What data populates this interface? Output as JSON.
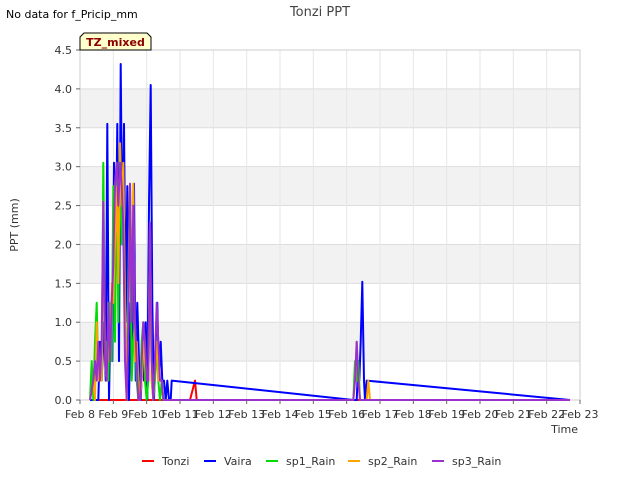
{
  "chart_data": {
    "type": "line",
    "title": "Tonzi PPT",
    "note": "No data for f_Pricip_mm",
    "badge": "TZ_mixed",
    "xlabel": "Time",
    "ylabel": "PPT (mm)",
    "xlim": [
      8,
      23
    ],
    "ylim": [
      0,
      4.5
    ],
    "x_ticks": [
      {
        "v": 8,
        "label": "Feb 8"
      },
      {
        "v": 9,
        "label": "Feb 9"
      },
      {
        "v": 10,
        "label": "Feb 10"
      },
      {
        "v": 11,
        "label": "Feb 11"
      },
      {
        "v": 12,
        "label": "Feb 12"
      },
      {
        "v": 13,
        "label": "Feb 13"
      },
      {
        "v": 14,
        "label": "Feb 14"
      },
      {
        "v": 15,
        "label": "Feb 15"
      },
      {
        "v": 16,
        "label": "Feb 16"
      },
      {
        "v": 17,
        "label": "Feb 17"
      },
      {
        "v": 18,
        "label": "Feb 18"
      },
      {
        "v": 19,
        "label": "Feb 19"
      },
      {
        "v": 20,
        "label": "Feb 20"
      },
      {
        "v": 21,
        "label": "Feb 21"
      },
      {
        "v": 22,
        "label": "Feb 22"
      },
      {
        "v": 23,
        "label": "Feb 23"
      }
    ],
    "y_ticks": [
      {
        "v": 0,
        "label": "0.0"
      },
      {
        "v": 0.5,
        "label": "0.5"
      },
      {
        "v": 1,
        "label": "1.0"
      },
      {
        "v": 1.5,
        "label": "1.5"
      },
      {
        "v": 2,
        "label": "2.0"
      },
      {
        "v": 2.5,
        "label": "2.5"
      },
      {
        "v": 3,
        "label": "3.0"
      },
      {
        "v": 3.5,
        "label": "3.5"
      },
      {
        "v": 4,
        "label": "4.0"
      },
      {
        "v": 4.5,
        "label": "4.5"
      }
    ],
    "grid": true,
    "legend": "bottom",
    "series": [
      {
        "name": "Tonzi",
        "color": "#ff0000",
        "x": [
          8.3,
          11.3,
          11.45,
          11.5,
          22.7
        ],
        "y": [
          0,
          0,
          0.25,
          0,
          0
        ]
      },
      {
        "name": "Vaira",
        "color": "#0000ff",
        "x": [
          8.3,
          8.55,
          8.6,
          8.65,
          8.72,
          8.77,
          8.82,
          8.87,
          8.92,
          8.97,
          9.02,
          9.07,
          9.12,
          9.17,
          9.22,
          9.27,
          9.32,
          9.37,
          9.42,
          9.47,
          9.52,
          9.57,
          9.62,
          9.67,
          9.72,
          9.77,
          9.82,
          9.87,
          9.92,
          9.97,
          10.02,
          10.07,
          10.12,
          10.17,
          10.22,
          10.27,
          10.32,
          10.37,
          10.42,
          10.47,
          10.52,
          10.57,
          10.62,
          10.67,
          10.72,
          10.75,
          16.2,
          16.3,
          16.35,
          16.38,
          16.42,
          16.47,
          16.52,
          16.55,
          16.6,
          22.7
        ],
        "y": [
          0,
          0,
          0.75,
          0.25,
          1.0,
          0.25,
          3.55,
          0,
          1.25,
          0.5,
          3.05,
          1.75,
          3.55,
          0.5,
          4.32,
          2.0,
          3.55,
          1.0,
          2.75,
          0,
          1.25,
          0.5,
          2.78,
          0.25,
          1.25,
          0.5,
          0,
          0.5,
          0.25,
          1.0,
          0,
          2.52,
          4.05,
          1.25,
          0,
          0.75,
          1.25,
          0.25,
          0.75,
          0.25,
          0.25,
          0,
          0.25,
          0,
          0,
          0.25,
          0,
          0,
          0.5,
          0.25,
          0.75,
          1.52,
          0.25,
          0,
          0.25,
          0
        ]
      },
      {
        "name": "sp1_Rain",
        "color": "#00dd00",
        "x": [
          8.3,
          8.35,
          8.4,
          8.45,
          8.5,
          8.55,
          8.6,
          8.65,
          8.7,
          8.75,
          8.8,
          8.85,
          8.9,
          8.95,
          9.0,
          9.05,
          9.1,
          9.15,
          9.2,
          9.25,
          9.3,
          9.35,
          9.4,
          9.45,
          9.5,
          9.55,
          9.6,
          9.65,
          9.7,
          9.75,
          9.8,
          9.85,
          9.9,
          9.95,
          10.0,
          10.05,
          10.1,
          10.15,
          10.2,
          10.25,
          10.3,
          10.35,
          10.4,
          10.45,
          10.5,
          16.2,
          16.25,
          16.3,
          16.35,
          16.4,
          22.7
        ],
        "y": [
          0,
          0.5,
          0,
          0.75,
          1.25,
          0.25,
          0.5,
          0.25,
          3.05,
          0.5,
          0.75,
          0.25,
          1.25,
          0.5,
          2.75,
          0.75,
          3.05,
          1.0,
          3.28,
          2.0,
          2.55,
          0.75,
          0,
          1.5,
          2.78,
          0.25,
          0.75,
          1.0,
          0.25,
          0,
          0,
          0.75,
          1.0,
          0.25,
          0,
          0.25,
          2.0,
          0.25,
          0,
          0.25,
          0.75,
          0.25,
          0,
          0.25,
          0,
          0,
          0.5,
          0.25,
          0.5,
          0,
          0
        ]
      },
      {
        "name": "sp2_Rain",
        "color": "#ffa500",
        "x": [
          8.3,
          8.4,
          8.45,
          8.5,
          8.55,
          8.6,
          8.65,
          8.7,
          8.75,
          8.8,
          8.85,
          8.9,
          8.95,
          9.0,
          9.05,
          9.1,
          9.15,
          9.2,
          9.25,
          9.3,
          9.35,
          9.4,
          9.45,
          9.5,
          9.55,
          9.6,
          9.65,
          9.7,
          9.75,
          9.8,
          9.85,
          9.9,
          9.95,
          10.0,
          10.05,
          10.1,
          10.15,
          10.2,
          10.25,
          10.3,
          10.35,
          10.4,
          10.45,
          10.5,
          16.2,
          16.25,
          16.3,
          16.35,
          16.4,
          16.6,
          16.65,
          16.7,
          22.7
        ],
        "y": [
          0,
          0.25,
          0,
          1.0,
          0.25,
          0.5,
          0.25,
          2.55,
          0.5,
          0.25,
          1.0,
          0.5,
          1.5,
          1.25,
          2.05,
          2.75,
          1.5,
          3.3,
          2.5,
          3.05,
          1.25,
          0,
          1.0,
          2.78,
          1.25,
          2.78,
          0.5,
          0.75,
          0.25,
          0,
          0.25,
          0.75,
          0.5,
          0.25,
          0.25,
          2.28,
          0.25,
          0,
          0.5,
          0.75,
          0.25,
          0.25,
          0.25,
          0,
          0,
          0.25,
          0.75,
          0.25,
          0,
          0,
          0.25,
          0,
          0
        ]
      },
      {
        "name": "sp3_Rain",
        "color": "#9932cc",
        "x": [
          8.3,
          8.4,
          8.45,
          8.5,
          8.55,
          8.6,
          8.65,
          8.7,
          8.75,
          8.8,
          8.85,
          8.9,
          8.95,
          9.0,
          9.05,
          9.1,
          9.15,
          9.2,
          9.25,
          9.3,
          9.35,
          9.4,
          9.45,
          9.5,
          9.55,
          9.6,
          9.65,
          9.7,
          9.75,
          9.8,
          9.85,
          9.9,
          9.95,
          10.0,
          10.05,
          10.1,
          10.15,
          10.2,
          10.25,
          10.3,
          10.35,
          10.4,
          10.45,
          10.5,
          10.55,
          16.2,
          16.25,
          16.3,
          16.35,
          16.4,
          22.7
        ],
        "y": [
          0,
          0.25,
          0.5,
          0.25,
          0.75,
          0.25,
          0.75,
          2.55,
          0.5,
          0.25,
          1.25,
          0.5,
          1.25,
          1.75,
          2.78,
          3.05,
          2.5,
          3.05,
          2.75,
          2.25,
          0.5,
          0,
          1.0,
          2.78,
          1.0,
          2.5,
          1.0,
          0.5,
          0,
          0,
          0.5,
          1.0,
          0.75,
          0.25,
          0.25,
          2.28,
          0.5,
          0,
          0.5,
          1.25,
          0.75,
          0.25,
          0.25,
          0,
          0,
          0,
          0.25,
          0.75,
          0.25,
          0,
          0
        ]
      }
    ]
  }
}
